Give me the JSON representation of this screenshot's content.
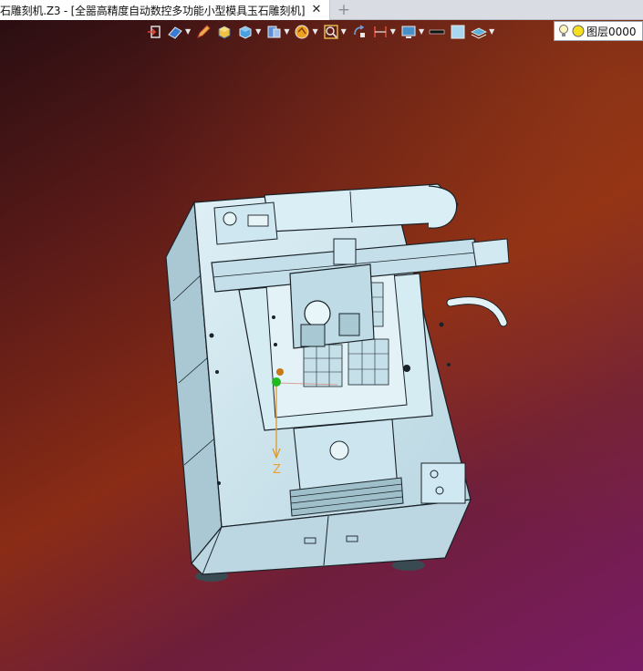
{
  "tab": {
    "title": "石雕刻机.Z3 - [全噐高精度自动数控多功能小型模具玉石雕刻机]",
    "close_glyph": "✕",
    "new_glyph": "+"
  },
  "toolbar": {
    "buttons": [
      {
        "name": "exit-view-icon",
        "color": "#e04a3a"
      },
      {
        "name": "view-orient-icon",
        "color": "#3a7bd5"
      },
      {
        "name": "pencil-icon",
        "color": "#e8b04a"
      },
      {
        "name": "shaded-box-icon",
        "color": "#f0c040"
      },
      {
        "name": "cube-display-icon",
        "color": "#4aa0e0"
      },
      {
        "name": "section-view-icon",
        "color": "#5c8fd8"
      },
      {
        "name": "render-mode-icon",
        "color": "#f0a020"
      },
      {
        "name": "zoom-fit-icon",
        "color": "#e8c050"
      },
      {
        "name": "rotate-view-icon",
        "color": "#6fa0e0"
      },
      {
        "name": "measure-icon",
        "color": "#e04a3a"
      },
      {
        "name": "display-settings-icon",
        "color": "#4a90c8"
      },
      {
        "name": "line-color-icon",
        "color": "#111111"
      },
      {
        "name": "face-color-icon",
        "color": "#a8d8f0"
      },
      {
        "name": "layer-stack-icon",
        "color": "#5bb0d8"
      }
    ],
    "layer_label": "图层0000"
  },
  "viewport": {
    "axis_label": "Z",
    "model_color": "#cde6ef",
    "edge_color": "#1a2228"
  }
}
